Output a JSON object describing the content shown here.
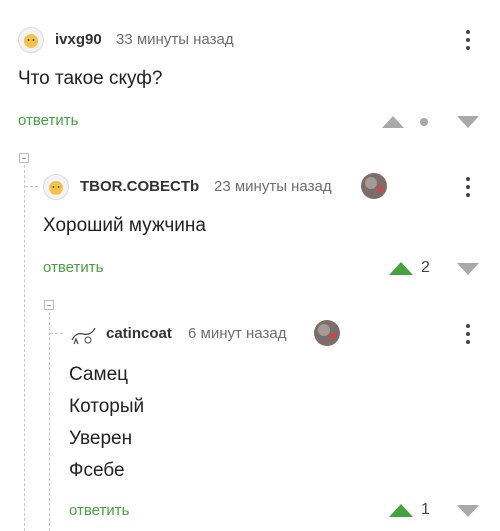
{
  "comments": [
    {
      "username": "ivxg90",
      "time": "33 минуты назад",
      "lines": [
        "Что такое скуф?"
      ],
      "reply_label": "ответить",
      "rating": ""
    },
    {
      "username": "TBOR.COBECTb",
      "time": "23 минуты назад",
      "lines": [
        "Хороший мужчина"
      ],
      "reply_label": "ответить",
      "rating": "2"
    },
    {
      "username": "catincoat",
      "time": "6 минут назад",
      "lines": [
        "Самец",
        "Который",
        "Уверен",
        "Фсебе"
      ],
      "reply_label": "ответить",
      "rating": "1"
    }
  ],
  "colors": {
    "accent_green": "#46a13f",
    "arrow_gray": "#a9a9a9",
    "text": "#222222"
  },
  "icons": [
    "kebab-menu-icon",
    "upvote-arrow-icon",
    "downvote-arrow-icon",
    "collapse-thread-icon",
    "heart-badge-icon"
  ]
}
